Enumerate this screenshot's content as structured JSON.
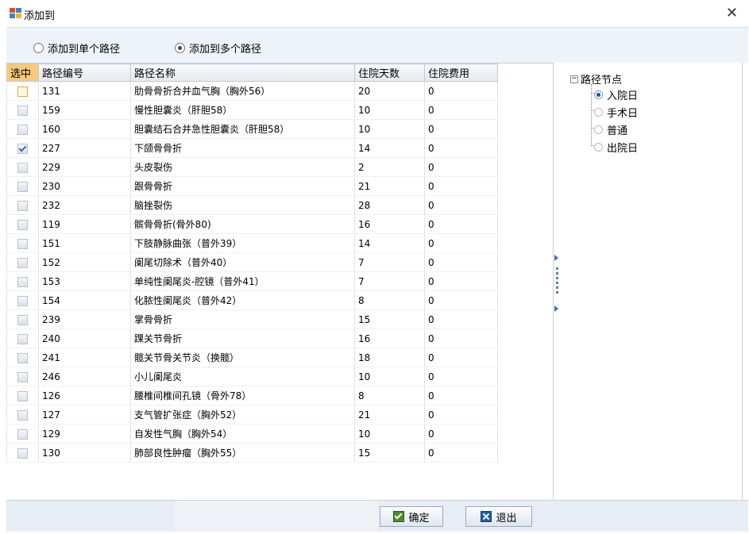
{
  "window": {
    "title": "添加到"
  },
  "options": {
    "single": "添加到单个路径",
    "multi": "添加到多个路径",
    "selected": "multi"
  },
  "grid": {
    "columns": [
      "选中",
      "路径编号",
      "路径名称",
      "住院天数",
      "住院费用"
    ],
    "rows": [
      {
        "checked": false,
        "code": "131",
        "name": "肋骨骨折合并血气胸（胸外56）",
        "days": "20",
        "fee": "0"
      },
      {
        "checked": false,
        "code": "159",
        "name": "慢性胆囊炎（肝胆58）",
        "days": "10",
        "fee": "0"
      },
      {
        "checked": false,
        "code": "160",
        "name": "胆囊结石合并急性胆囊炎（肝胆58）",
        "days": "10",
        "fee": "0"
      },
      {
        "checked": true,
        "code": "227",
        "name": "下颌骨骨折",
        "days": "14",
        "fee": "0"
      },
      {
        "checked": false,
        "code": "229",
        "name": "头皮裂伤",
        "days": "2",
        "fee": "0"
      },
      {
        "checked": false,
        "code": "230",
        "name": "跟骨骨折",
        "days": "21",
        "fee": "0"
      },
      {
        "checked": false,
        "code": "232",
        "name": "脑挫裂伤",
        "days": "28",
        "fee": "0"
      },
      {
        "checked": false,
        "code": "119",
        "name": "髌骨骨折(骨外80)",
        "days": "16",
        "fee": "0"
      },
      {
        "checked": false,
        "code": "151",
        "name": "下肢静脉曲张（普外39）",
        "days": "14",
        "fee": "0"
      },
      {
        "checked": false,
        "code": "152",
        "name": "阑尾切除术（普外40）",
        "days": "7",
        "fee": "0"
      },
      {
        "checked": false,
        "code": "153",
        "name": "单纯性阑尾炎-腔镜（普外41）",
        "days": "7",
        "fee": "0"
      },
      {
        "checked": false,
        "code": "154",
        "name": "化脓性阑尾炎（普外42）",
        "days": "8",
        "fee": "0"
      },
      {
        "checked": false,
        "code": "239",
        "name": "掌骨骨折",
        "days": "15",
        "fee": "0"
      },
      {
        "checked": false,
        "code": "240",
        "name": "踝关节骨折",
        "days": "16",
        "fee": "0"
      },
      {
        "checked": false,
        "code": "241",
        "name": "髋关节骨关节炎（换髋）",
        "days": "18",
        "fee": "0"
      },
      {
        "checked": false,
        "code": "246",
        "name": "小儿阑尾炎",
        "days": "10",
        "fee": "0"
      },
      {
        "checked": false,
        "code": "126",
        "name": "腰椎间椎间孔镜（骨外78）",
        "days": "8",
        "fee": "0"
      },
      {
        "checked": false,
        "code": "127",
        "name": "支气管扩张症（胸外52）",
        "days": "21",
        "fee": "0"
      },
      {
        "checked": false,
        "code": "129",
        "name": "自发性气胸（胸外54）",
        "days": "10",
        "fee": "0"
      },
      {
        "checked": false,
        "code": "130",
        "name": "肺部良性肿瘤（胸外55）",
        "days": "15",
        "fee": "0"
      }
    ]
  },
  "tree": {
    "root": "路径节点",
    "nodes": [
      {
        "label": "入院日",
        "selected": true
      },
      {
        "label": "手术日",
        "selected": false
      },
      {
        "label": "普通",
        "selected": false
      },
      {
        "label": "出院日",
        "selected": false
      }
    ]
  },
  "buttons": {
    "ok": "确定",
    "exit": "退出"
  }
}
